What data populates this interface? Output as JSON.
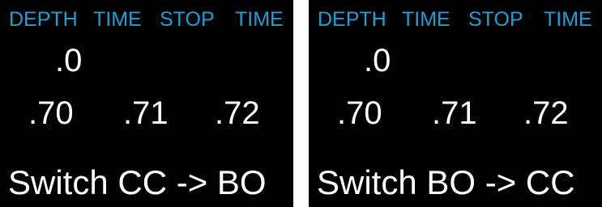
{
  "colors": {
    "background": "#000000",
    "header": "#1aa0d8",
    "text": "#ffffff",
    "separator": "#ffffff"
  },
  "screens": [
    {
      "headers": [
        "DEPTH",
        "TIME",
        "STOP",
        "TIME"
      ],
      "first_stop": ".0",
      "row_values": [
        ".70",
        ".71",
        ".72"
      ],
      "switch_text": "Switch CC -> BO"
    },
    {
      "headers": [
        "DEPTH",
        "TIME",
        "STOP",
        "TIME"
      ],
      "first_stop": ".0",
      "row_values": [
        ".70",
        ".71",
        ".72"
      ],
      "switch_text": "Switch BO -> CC"
    }
  ]
}
